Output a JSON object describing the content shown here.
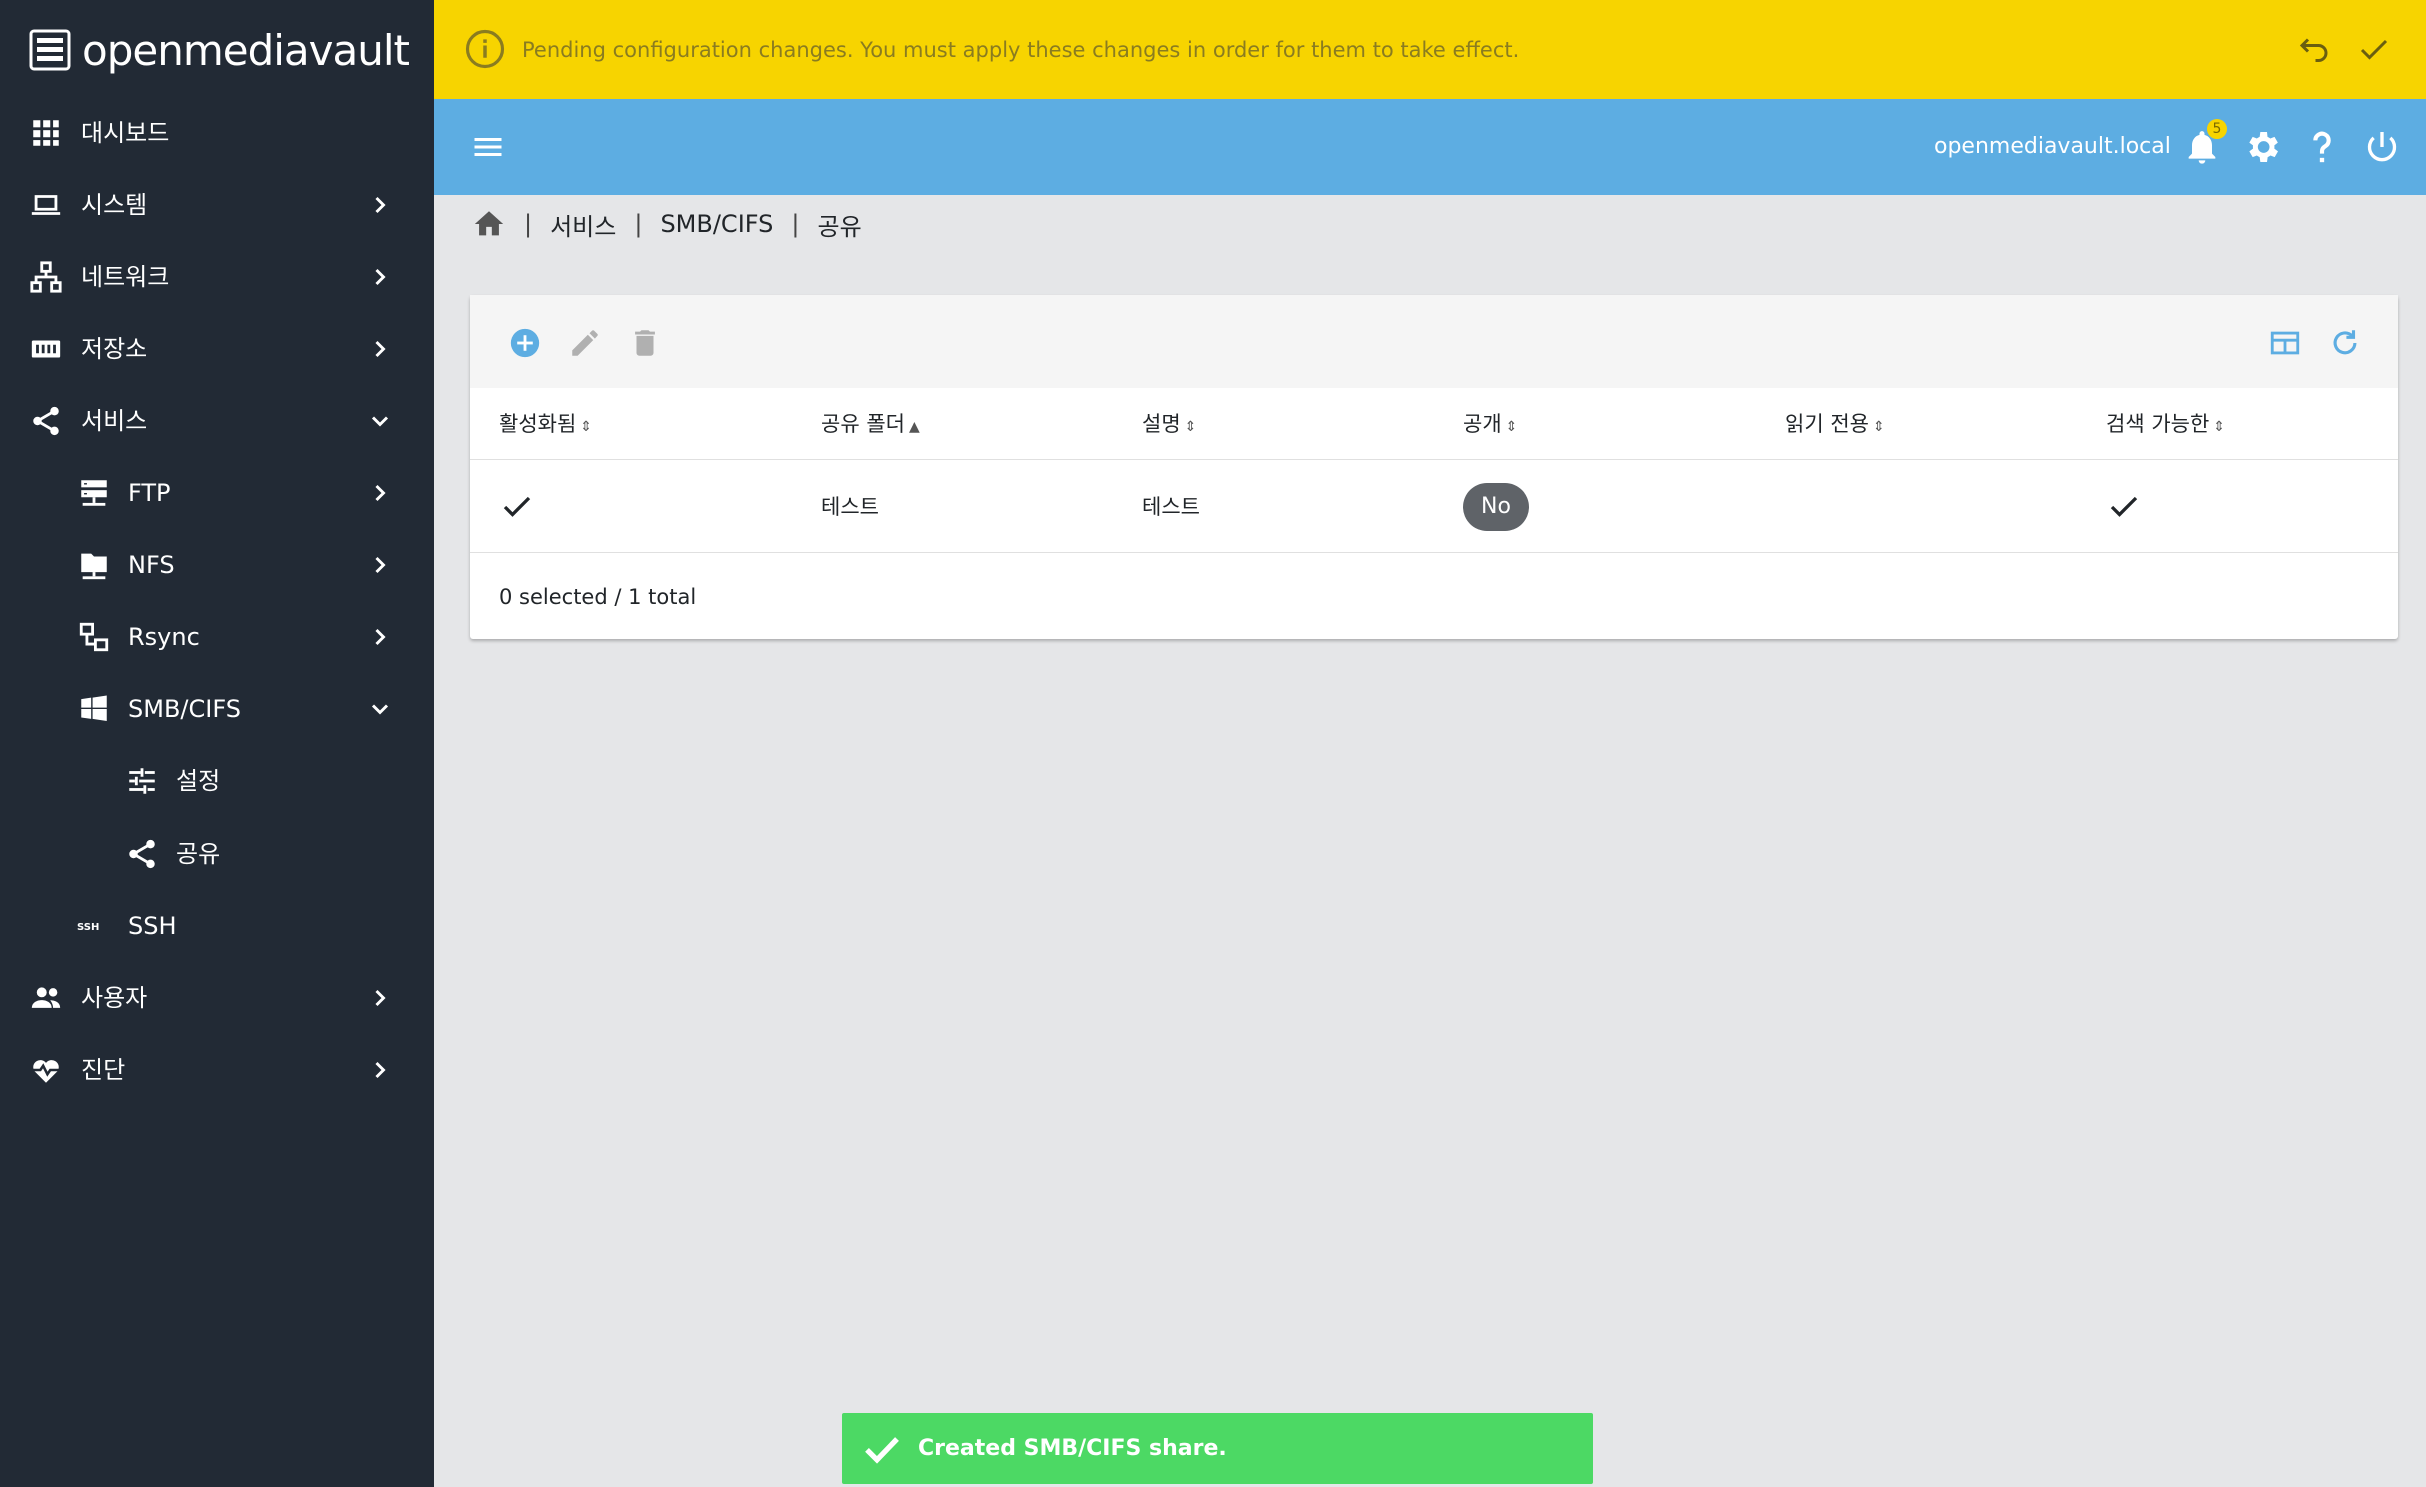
{
  "brand": {
    "name": "openmediavault"
  },
  "sidebar": {
    "items": [
      {
        "label": "대시보드",
        "icon": "dashboard-icon"
      },
      {
        "label": "시스템",
        "icon": "laptop-icon"
      },
      {
        "label": "네트워크",
        "icon": "network-icon"
      },
      {
        "label": "저장소",
        "icon": "storage-icon"
      },
      {
        "label": "서비스",
        "icon": "share-icon"
      },
      {
        "label": "FTP",
        "icon": "server-icon"
      },
      {
        "label": "NFS",
        "icon": "folder-network-icon"
      },
      {
        "label": "Rsync",
        "icon": "rsync-icon"
      },
      {
        "label": "SMB/CIFS",
        "icon": "windows-icon"
      },
      {
        "label": "설정",
        "icon": "tune-icon"
      },
      {
        "label": "공유",
        "icon": "share-icon"
      },
      {
        "label": "SSH",
        "icon": "ssh-icon"
      },
      {
        "label": "사용자",
        "icon": "users-icon"
      },
      {
        "label": "진단",
        "icon": "heart-pulse-icon"
      }
    ]
  },
  "banner": {
    "message": "Pending configuration changes. You must apply these changes in order for them to take effect.",
    "color": "#f7d400"
  },
  "topbar": {
    "hostname": "openmediavault.local",
    "notification_count": "5",
    "color": "#5dade2"
  },
  "breadcrumb": {
    "items": [
      "서비스",
      "SMB/CIFS",
      "공유"
    ]
  },
  "table": {
    "columns": [
      "활성화됨",
      "공유 폴더",
      "설명",
      "공개",
      "읽기 전용",
      "검색 가능한"
    ],
    "rows": [
      {
        "enabled": true,
        "shared_folder": "테스트",
        "description": "테스트",
        "public": "No",
        "read_only": false,
        "browseable": true
      }
    ],
    "footer": "0 selected / 1 total"
  },
  "toast": {
    "message": "Created SMB/CIFS share.",
    "color": "#4cd964"
  }
}
